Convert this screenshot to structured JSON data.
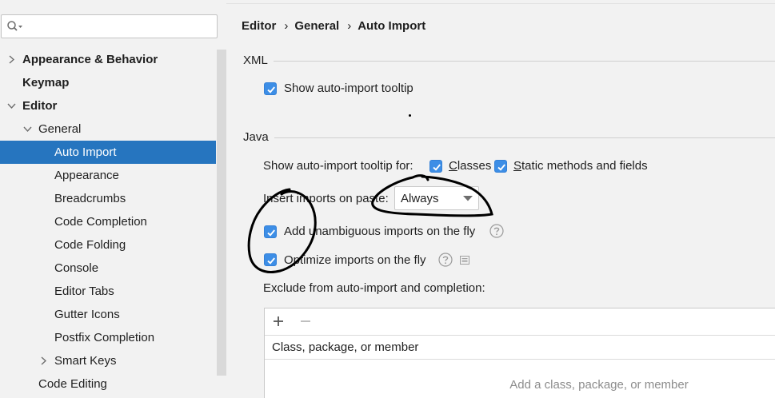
{
  "colors": {
    "selection": "#2675bf",
    "checkbox": "#3d8ee6",
    "annotation": "#000000",
    "panel_background": "#f2f2f2"
  },
  "search": {
    "value": "",
    "placeholder": "",
    "icon": "search-icon"
  },
  "sidebar": {
    "items": [
      {
        "label": "Appearance & Behavior",
        "expanded": false,
        "has_children": true
      },
      {
        "label": "Keymap"
      },
      {
        "label": "Editor",
        "expanded": true,
        "has_children": true
      },
      {
        "label": "General",
        "expanded": true,
        "has_children": true
      },
      {
        "label": "Auto Import",
        "selected": true
      },
      {
        "label": "Appearance"
      },
      {
        "label": "Breadcrumbs"
      },
      {
        "label": "Code Completion"
      },
      {
        "label": "Code Folding"
      },
      {
        "label": "Console"
      },
      {
        "label": "Editor Tabs"
      },
      {
        "label": "Gutter Icons"
      },
      {
        "label": "Postfix Completion"
      },
      {
        "label": "Smart Keys",
        "expanded": false,
        "has_children": true
      },
      {
        "label": "Code Editing"
      }
    ]
  },
  "breadcrumb": {
    "items": [
      "Editor",
      "General",
      "Auto Import"
    ],
    "separator": "›"
  },
  "xml": {
    "title": "XML",
    "show_tooltip": {
      "label": "Show auto-import tooltip",
      "checked": true
    }
  },
  "java": {
    "title": "Java",
    "tooltip_for": {
      "label": "Show auto-import tooltip for:",
      "classes": {
        "label": "Classes",
        "checked": true
      },
      "static_members": {
        "label": "Static methods and fields",
        "checked": true
      }
    },
    "insert_on_paste": {
      "label": "Insert imports on paste:",
      "value": "Always"
    },
    "add_unambiguous": {
      "label": "Add unambiguous imports on the fly",
      "checked": true,
      "help_icon": "question-icon"
    },
    "optimize": {
      "label": "Optimize imports on the fly",
      "checked": true,
      "help_icon": "question-icon",
      "extra_icon": "document-icon"
    }
  },
  "exclude": {
    "label": "Exclude from auto-import and completion:",
    "toolbar": {
      "add_icon": "plus-icon",
      "remove_icon": "minus-icon",
      "remove_enabled": false
    },
    "column_header": "Class, package, or member",
    "empty_text": "Add a class, package, or member"
  }
}
